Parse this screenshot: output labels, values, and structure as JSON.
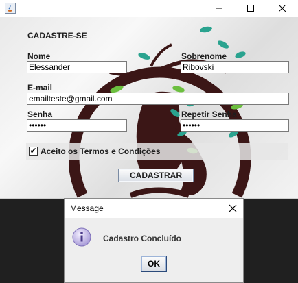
{
  "window": {
    "title": "",
    "icons": {
      "app": "java-cup-icon",
      "minimize": "minimize-icon",
      "maximize": "maximize-icon",
      "close": "close-icon"
    }
  },
  "form": {
    "heading": "CADASTRE-SE",
    "nome_label": "Nome",
    "nome_value": "Elessander",
    "sobrenome_label": "Sobrenome",
    "sobrenome_value": "Ribovski",
    "email_label": "E-mail",
    "email_value": "emailteste@gmail.com",
    "senha_label": "Senha",
    "senha_value": "••••••",
    "repetir_label": "Repetir Senha",
    "repetir_value": "••••••",
    "terms_label": "Aceito os Termos e Condições",
    "terms_checked": true,
    "terms_mark": "✔",
    "submit_label": "CADASTRAR"
  },
  "dialog": {
    "title": "Message",
    "message": "Cadastro Concluído",
    "ok_label": "OK",
    "icon": "info-icon"
  },
  "colors": {
    "logo_brown": "#3b1616",
    "leaf_teal": "#2aa38f",
    "leaf_green": "#6cbf3f",
    "accent_border": "#2b4a7a"
  }
}
